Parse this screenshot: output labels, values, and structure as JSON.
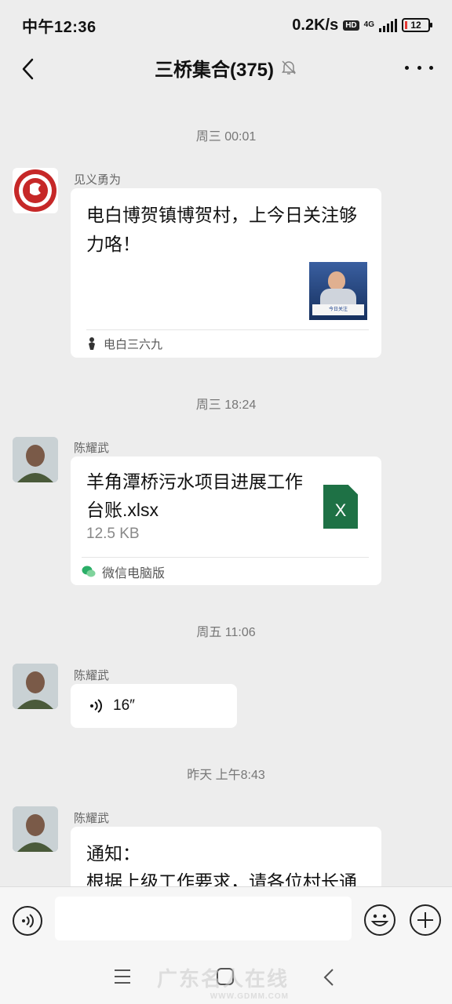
{
  "status_bar": {
    "time": "中午12:36",
    "net_speed": "0.2K/s",
    "hd": "HD",
    "network": "4G",
    "battery": "12"
  },
  "header": {
    "title": "三桥集合(375)"
  },
  "messages": [
    {
      "timestamp": "周三 00:01",
      "sender": "见义勇为",
      "text": "电白博贺镇博贺村，上今日关注够力咯！",
      "source": "电白三六九",
      "thumb_caption": "今日关注"
    },
    {
      "timestamp": "周三 18:24",
      "sender": "陈耀武",
      "file_name": "羊角潭桥污水项目进展工作台账.xlsx",
      "file_size": "12.5 KB",
      "file_icon_letter": "X",
      "source": "微信电脑版"
    },
    {
      "timestamp": "周五 11:06",
      "sender": "陈耀武",
      "duration": "16″"
    },
    {
      "timestamp": "昨天 上午8:43",
      "sender": "陈耀武",
      "text_line1": "通知：",
      "text_line2": "根据上级工作要求，请各位村长通"
    }
  ],
  "watermark": {
    "text": "广东名人在线",
    "url": "WWW.GDMM.COM"
  },
  "colors": {
    "background": "#ededed",
    "bubble": "#ffffff",
    "excel_green": "#1e7145",
    "logo_red": "#c62828"
  }
}
